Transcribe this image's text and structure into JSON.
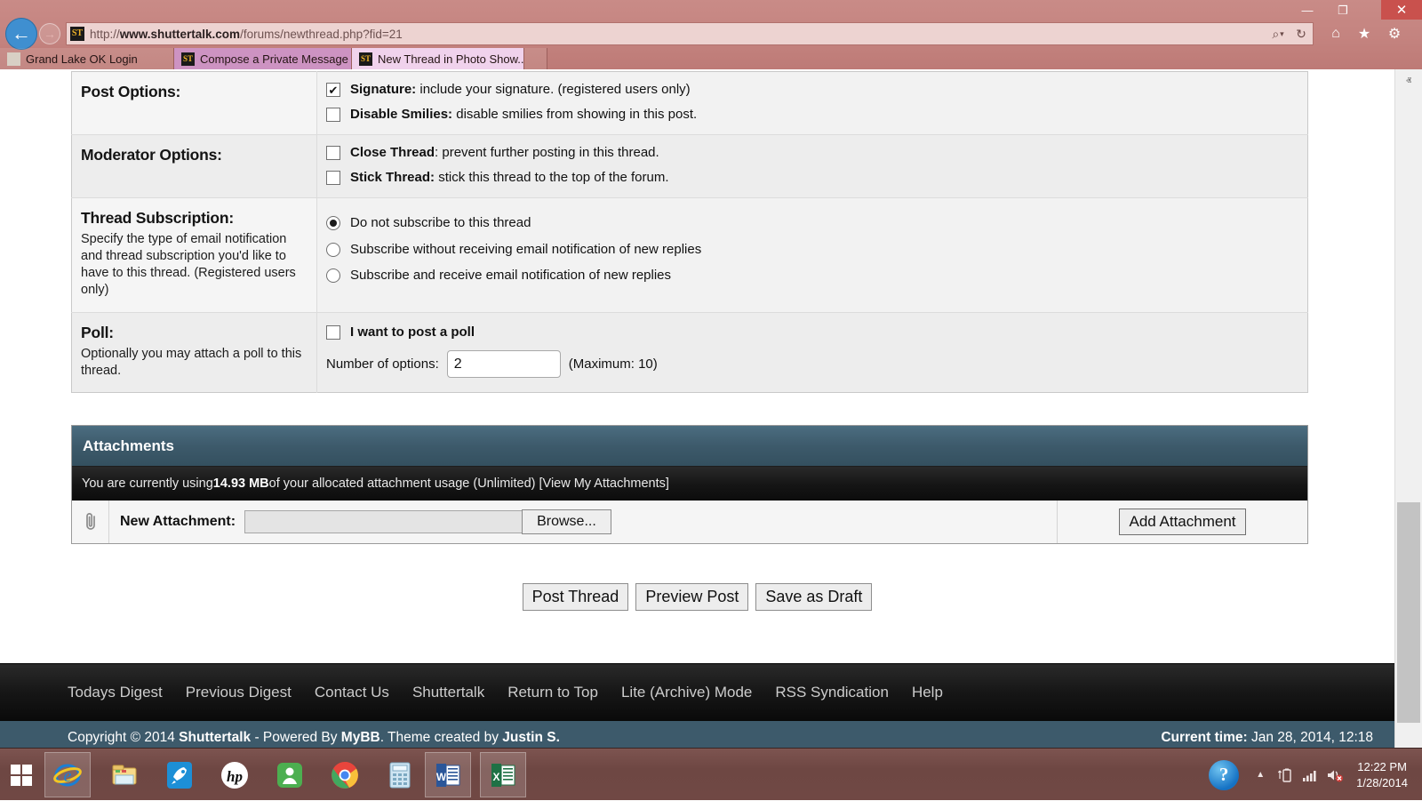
{
  "browser": {
    "window_controls": {
      "minimize": "—",
      "maximize": "❐",
      "close": "✕"
    },
    "back_icon": "←",
    "forward_icon": "→",
    "url": "http://www.shuttertalk.com/forums/newthread.php?fid=21",
    "url_host": "www.shuttertalk.com",
    "url_prefix": "http://",
    "url_path": "/forums/newthread.php?fid=21",
    "favicon_text": "ST",
    "search_icon": "⌕",
    "search_caret": "▾",
    "refresh_icon": "↻",
    "home_icon": "⌂",
    "favorites_icon": "★",
    "tools_icon": "⚙",
    "tabs": [
      {
        "title": "Grand Lake OK Login",
        "favicon": "generic-favicon",
        "active": false
      },
      {
        "title": "Compose a Private Message",
        "favicon": "ST",
        "active": false
      },
      {
        "title": "New Thread in Photo Show...",
        "favicon": "ST",
        "active": true,
        "close_icon": "✕"
      }
    ]
  },
  "form": {
    "rows": [
      {
        "title": "Post Options:",
        "desc": "",
        "options": [
          {
            "type": "checkbox",
            "checked": true,
            "bold": "Signature:",
            "rest": " include your signature. (registered users only)"
          },
          {
            "type": "checkbox",
            "checked": false,
            "bold": "Disable Smilies:",
            "rest": " disable smilies from showing in this post."
          }
        ]
      },
      {
        "title": "Moderator Options:",
        "desc": "",
        "options": [
          {
            "type": "checkbox",
            "checked": false,
            "bold": "Close Thread",
            "rest": ": prevent further posting in this thread."
          },
          {
            "type": "checkbox",
            "checked": false,
            "bold": "Stick Thread:",
            "rest": " stick this thread to the top of the forum."
          }
        ]
      },
      {
        "title": "Thread Subscription:",
        "desc": "Specify the type of email notification and thread subscription you'd like to have to this thread. (Registered users only)",
        "options": [
          {
            "type": "radio",
            "checked": true,
            "bold": "",
            "rest": "Do not subscribe to this thread"
          },
          {
            "type": "radio",
            "checked": false,
            "bold": "",
            "rest": "Subscribe without receiving email notification of new replies"
          },
          {
            "type": "radio",
            "checked": false,
            "bold": "",
            "rest": "Subscribe and receive email notification of new replies"
          }
        ]
      },
      {
        "title": "Poll:",
        "desc": "Optionally you may attach a poll to this thread.",
        "options": [
          {
            "type": "checkbox",
            "checked": false,
            "bold": "I want to post a poll",
            "rest": ""
          }
        ],
        "poll": {
          "num_options_label": "Number of options:",
          "num_options_value": "2",
          "maximum_note": "(Maximum: 10)"
        }
      }
    ]
  },
  "attachments": {
    "header": "Attachments",
    "usage_prefix": "You are currently using ",
    "usage_amount": "14.93 MB",
    "usage_suffix": " of your allocated attachment usage (Unlimited) [View My Attachments]",
    "paperclip_icon": "📎",
    "new_attachment_label": "New Attachment:",
    "file_input_value": "",
    "browse_label": "Browse...",
    "add_attachment_label": "Add Attachment"
  },
  "submit_buttons": [
    {
      "label": "Post Thread"
    },
    {
      "label": "Preview Post"
    },
    {
      "label": "Save as Draft"
    }
  ],
  "footer": {
    "links": [
      "Todays Digest",
      "Previous Digest",
      "Contact Us",
      "Shuttertalk",
      "Return to Top",
      "Lite (Archive) Mode",
      "RSS Syndication",
      "Help"
    ],
    "copyright_prefix": "Copyright © 2014 ",
    "copyright_site": "Shuttertalk",
    "copyright_mid": " - Powered By ",
    "copyright_engine": "MyBB",
    "copyright_theme": ". Theme created by ",
    "copyright_author": "Justin S.",
    "current_time_label": "Current time:",
    "current_time_value": "Jan 28, 2014, 12:18"
  },
  "scrollbar": {
    "up_icon": "ⱏ",
    "down_icon": "ⱟ"
  },
  "taskbar": {
    "start_name": "windows-start",
    "items": [
      {
        "name": "internet-explorer",
        "running": true
      },
      {
        "name": "file-explorer",
        "running": false
      },
      {
        "name": "rocket-app",
        "running": false
      },
      {
        "name": "hp-support-assistant",
        "running": false
      },
      {
        "name": "quicken-app",
        "running": false
      },
      {
        "name": "google-chrome",
        "running": false
      },
      {
        "name": "calculator",
        "running": false
      },
      {
        "name": "microsoft-word",
        "running": true
      },
      {
        "name": "microsoft-excel",
        "running": true
      }
    ],
    "tray": {
      "help_icon": "?",
      "show_hidden_icon": "▲",
      "battery_icon": "▀",
      "network_icon": "▃",
      "volume_icon": "🔇",
      "time": "12:22 PM",
      "date": "1/28/2014"
    }
  }
}
